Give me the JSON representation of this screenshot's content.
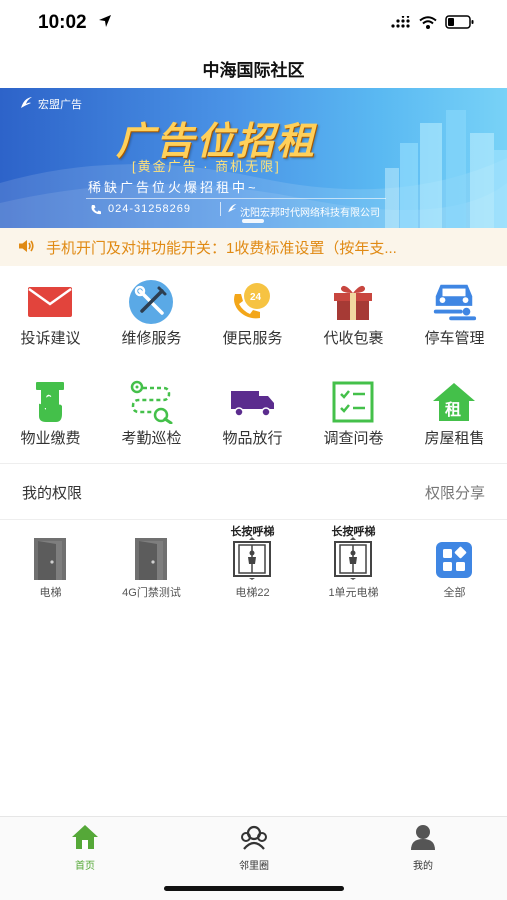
{
  "status_bar": {
    "time": "10:02"
  },
  "nav": {
    "title": "中海国际社区"
  },
  "banner": {
    "brand": "宏盟广告",
    "title": "广告位招租",
    "slogan": "[黄金广告 · 商机无限]",
    "tagline": "稀缺广告位火爆招租中~",
    "phone": "024-31258269",
    "company": "沈阳宏邦时代网络科技有限公司"
  },
  "notice": {
    "text": "手机开门及对讲功能开关：1收费标准设置（按年支..."
  },
  "grid": {
    "row1": [
      {
        "label": "投诉建议",
        "icon": "mail-icon"
      },
      {
        "label": "维修服务",
        "icon": "tools-icon"
      },
      {
        "label": "便民服务",
        "icon": "phone-24h-icon"
      },
      {
        "label": "代收包裹",
        "icon": "gift-box-icon"
      },
      {
        "label": "停车管理",
        "icon": "car-icon"
      }
    ],
    "row2": [
      {
        "label": "物业缴费",
        "icon": "atm-pay-icon"
      },
      {
        "label": "考勤巡检",
        "icon": "route-check-icon"
      },
      {
        "label": "物品放行",
        "icon": "truck-icon"
      },
      {
        "label": "调查问卷",
        "icon": "checklist-icon"
      },
      {
        "label": "房屋租售",
        "icon": "house-rent-icon"
      }
    ]
  },
  "colors": {
    "orange": "#e08a14",
    "red": "#e2443c",
    "blue": "#3f86e3",
    "green": "#44c04a",
    "purple": "#5b2c8e",
    "tab_active": "#55a838"
  },
  "permissions": {
    "title": "我的权限",
    "share": "权限分享",
    "items": [
      {
        "label": "电梯",
        "tag": "",
        "icon": "door-icon"
      },
      {
        "label": "4G门禁测试",
        "tag": "",
        "icon": "door-icon"
      },
      {
        "label": "电梯22",
        "tag": "长按呼梯",
        "icon": "elevator-icon"
      },
      {
        "label": "1单元电梯",
        "tag": "长按呼梯",
        "icon": "elevator-icon"
      },
      {
        "label": "全部",
        "tag": "",
        "icon": "all-apps-icon"
      }
    ]
  },
  "tabs": [
    {
      "label": "首页",
      "active": true,
      "icon": "home-icon"
    },
    {
      "label": "邻里圈",
      "active": false,
      "icon": "neighbors-icon"
    },
    {
      "label": "我的",
      "active": false,
      "icon": "profile-icon"
    }
  ]
}
